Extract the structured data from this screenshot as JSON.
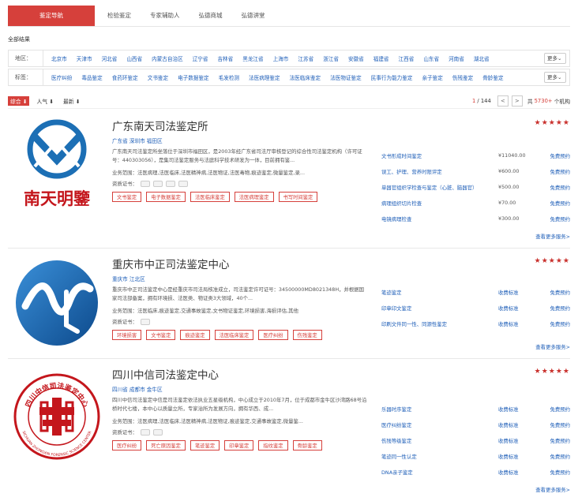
{
  "nav": {
    "tabs": [
      "鉴定导航",
      "检验鉴定",
      "专家辅助人",
      "弘德商城",
      "弘德讲堂"
    ]
  },
  "all_results": "全部结果",
  "filters": {
    "region": {
      "label": "地区：",
      "options": [
        "北京市",
        "天津市",
        "河北省",
        "山西省",
        "内蒙古自治区",
        "辽宁省",
        "吉林省",
        "黑龙江省",
        "上海市",
        "江苏省",
        "浙江省",
        "安徽省",
        "福建省",
        "江西省",
        "山东省",
        "河南省",
        "湖北省"
      ],
      "more": "更多"
    },
    "tags": {
      "label": "标签：",
      "options": [
        "医疗纠纷",
        "毒品鉴定",
        "食药环鉴定",
        "文书鉴定",
        "电子数据鉴定",
        "毛发检测",
        "法医病理鉴定",
        "法医临床鉴定",
        "法医物证鉴定",
        "民事行为能力鉴定",
        "亲子鉴定",
        "伤残鉴定",
        "骨龄鉴定"
      ],
      "more": "更多"
    }
  },
  "sort": {
    "options": [
      "综合",
      "人气",
      "最新"
    ]
  },
  "pager": {
    "page": "1",
    "total": "/ 144",
    "prev": "<",
    "next": ">",
    "count_prefix": "共",
    "count": "5730+",
    "count_suffix": "个机构"
  },
  "cards": [
    {
      "name": "广东南天司法鉴定所",
      "location": "广东省 深圳市 福田区",
      "logo_text": "南天明鑒",
      "desc": "广东南天司法鉴定所坐落位于深圳市福田区，是2003年经广东省司法厅审核登记的综合性司法鉴定机构（许可证号：440303056），是集司法鉴定服务与法庭科学技术研发为一体，目前拥有鉴...",
      "biz": "业务范围：法医病理,法医临床,法医精神病,法医物证,法医毒物,痕迹鉴定,微量鉴定,录...",
      "cert_label": "资质证书：",
      "tags": [
        "文书鉴定",
        "电子数据鉴定",
        "法医临床鉴定",
        "法医病理鉴定",
        "书写时间鉴定"
      ],
      "stars": "★★★★★",
      "services": [
        {
          "name": "文书形成时间鉴定",
          "price": "¥11040.00",
          "btn": "免费预约"
        },
        {
          "name": "误工、护理、营养时限评定",
          "price": "¥600.00",
          "btn": "免费预约"
        },
        {
          "name": "单器官组织学检查与鉴定（心脏、脑器官）",
          "price": "¥500.00",
          "btn": "免费预约"
        },
        {
          "name": "病理组织切片检查",
          "price": "¥70.00",
          "btn": "免费预约"
        },
        {
          "name": "电镜病理检查",
          "price": "¥300.00",
          "btn": "免费预约"
        }
      ],
      "see_more": "查看更多服务>"
    },
    {
      "name": "重庆市中正司法鉴定中心",
      "location": "重庆市 江北区",
      "desc": "重庆市中正司法鉴定中心是经重庆市司法局核准成立，司法鉴定许可证号：34500000MD8021348H，并根据国家司法部备案，拥有环境损、法医类、物证类3大领域，40个...",
      "biz": "业务范围：法医临床,痕迹鉴定,交通事故鉴定,文书物证鉴定,环境损害,海损评估,其他",
      "cert_label": "资质证书：",
      "tags": [
        "环境损害",
        "文书鉴定",
        "痕迹鉴定",
        "法医临床鉴定",
        "医疗纠纷",
        "伤残鉴定"
      ],
      "stars": "★★★★★",
      "services": [
        {
          "name": "笔迹鉴定",
          "price": "收费标准",
          "btn": "免费预约"
        },
        {
          "name": "印章印文鉴定",
          "price": "收费标准",
          "btn": "免费预约"
        },
        {
          "name": "印刷文件同一性、同源性鉴定",
          "price": "收费标准",
          "btn": "免费预约"
        }
      ],
      "see_more": "查看更多服务>"
    },
    {
      "name": "四川中信司法鉴定中心",
      "location": "四川省 成都市 金牛区",
      "seal_text": "四川中信司法鉴定中心",
      "seal_en": "SICHUAN ZHONGXIN FORENSIC SCIENCE CENTER",
      "desc": "四川中信司法鉴定中信是司法鉴定依法执业五星级机构，中心成立于2010年7月，位于成都市金牛区沙湾路68号沿桥时代七楼，本中心以质量立所，专家治所为发展方向，拥有华西、成...",
      "biz": "业务范围：法医病理,法医临床,法医精神病,法医物证,痕迹鉴定,交通事故鉴定,微量鉴...",
      "cert_label": "资质证书：",
      "tags": [
        "医疗纠纷",
        "死亡原因鉴定",
        "笔迹鉴定",
        "印章鉴定",
        "指纹鉴定",
        "骨龄鉴定"
      ],
      "stars": "★★★★★",
      "services": [
        {
          "name": "乐器时序鉴定",
          "price": "收费标准",
          "btn": "免费预约"
        },
        {
          "name": "医疗纠纷鉴定",
          "price": "收费标准",
          "btn": "免费预约"
        },
        {
          "name": "伤残等级鉴定",
          "price": "收费标准",
          "btn": "免费预约"
        },
        {
          "name": "笔迹同一性认定",
          "price": "收费标准",
          "btn": "免费预约"
        },
        {
          "name": "DNA亲子鉴定",
          "price": "收费标准",
          "btn": "免费预约"
        }
      ],
      "see_more": "查看更多服务>"
    }
  ],
  "colors": {
    "accent": "#d6403b",
    "link": "#1f5fb8",
    "logo_blue": "#1c6fb5",
    "logo_red": "#c4161c"
  }
}
